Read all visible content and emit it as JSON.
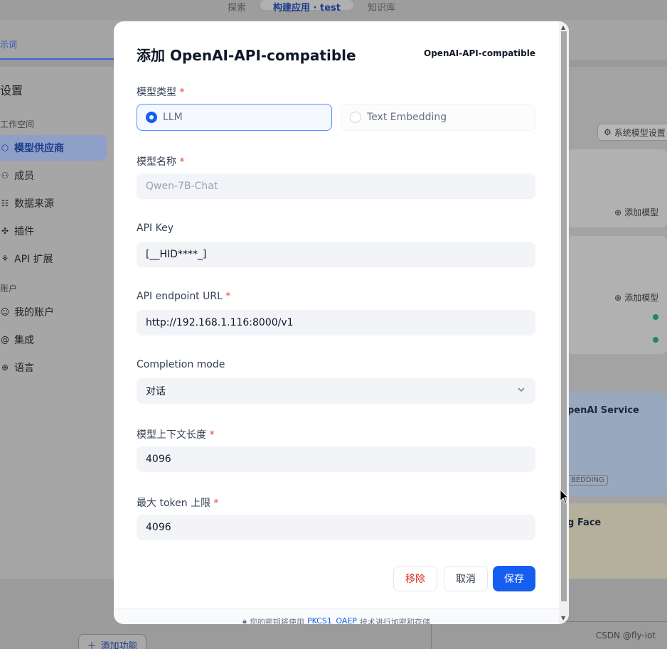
{
  "background": {
    "top_tabs": [
      "探索",
      "构建应用 · test",
      "知识库"
    ],
    "prompt_tab": "示词",
    "sidebar": {
      "title": "设置",
      "groups": [
        {
          "label": "工作空间",
          "items": [
            {
              "label": "模型供应商",
              "icon": "cube-icon",
              "active": true
            },
            {
              "label": "成员",
              "icon": "users-icon",
              "active": false
            },
            {
              "label": "数据来源",
              "icon": "database-icon",
              "active": false
            },
            {
              "label": "插件",
              "icon": "puzzle-icon",
              "active": false
            },
            {
              "label": "API 扩展",
              "icon": "webhook-icon",
              "active": false
            }
          ]
        },
        {
          "label": "账户",
          "items": [
            {
              "label": "我的账户",
              "icon": "user-icon",
              "active": false
            },
            {
              "label": "集成",
              "icon": "at-icon",
              "active": false
            },
            {
              "label": "语言",
              "icon": "globe-icon",
              "active": false
            }
          ]
        }
      ]
    },
    "right": {
      "system_model_settings": "系统模型设置",
      "add_model_1": "添加模型",
      "add_model_2": "添加模型",
      "provider_azure": "penAI Service",
      "tag_embedding": "BEDDING",
      "provider_hf": "g Face"
    },
    "bottom": {
      "add_function": "添加功能"
    },
    "watermark": "CSDN @fly-iot"
  },
  "modal": {
    "title": "添加 OpenAI-API-compatible",
    "brand": "OpenAI-API-compatible",
    "model_type": {
      "label": "模型类型",
      "options": [
        {
          "label": "LLM",
          "selected": true
        },
        {
          "label": "Text Embedding",
          "selected": false
        }
      ]
    },
    "model_name": {
      "label": "模型名称",
      "value": "",
      "placeholder": "Qwen-7B-Chat"
    },
    "api_key": {
      "label": "API Key",
      "value": "[__HID****_]"
    },
    "endpoint": {
      "label": "API endpoint URL",
      "value": "http://192.168.1.116:8000/v1"
    },
    "completion_mode": {
      "label": "Completion mode",
      "value": "对话"
    },
    "context_length": {
      "label": "模型上下文长度",
      "value": "4096"
    },
    "max_tokens": {
      "label": "最大 token 上限",
      "value": "4096"
    },
    "buttons": {
      "remove": "移除",
      "cancel": "取消",
      "save": "保存"
    },
    "footer": {
      "prefix": "您的密钥将使用",
      "link": "PKCS1_OAEP",
      "suffix": "技术进行加密和存储"
    }
  },
  "colors": {
    "primary": "#155eef",
    "danger": "#d92d20",
    "required": "#f04438"
  }
}
